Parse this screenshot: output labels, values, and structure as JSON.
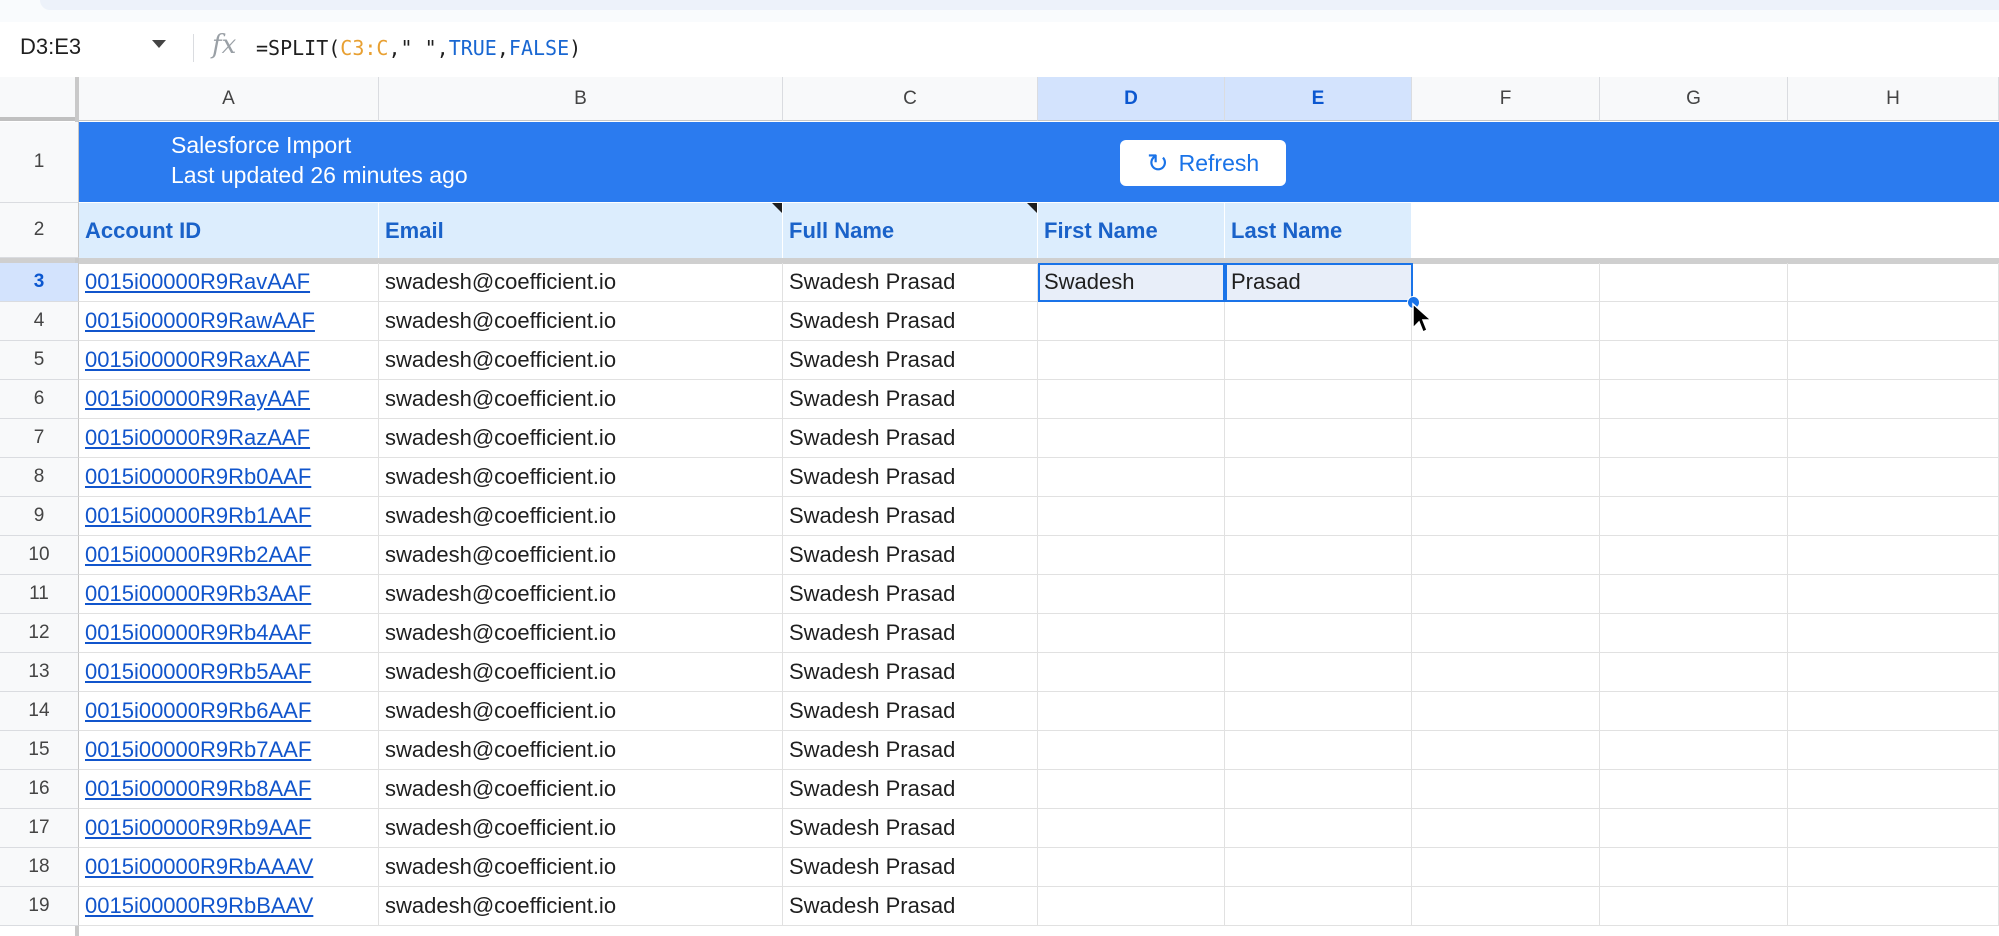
{
  "formula_bar": {
    "name_box": "D3:E3",
    "fx_label": "fx",
    "formula_parts": {
      "func": "=SPLIT(",
      "ref": "C3:C",
      "delim": ",\" \",",
      "arg1": "TRUE",
      "comma": ",",
      "arg2": "FALSE",
      "close": ")"
    }
  },
  "columns": [
    "A",
    "B",
    "C",
    "D",
    "E",
    "F",
    "G",
    "H"
  ],
  "selected_columns": [
    "D",
    "E"
  ],
  "row_numbers": [
    "1",
    "2",
    "3",
    "4",
    "5",
    "6",
    "7",
    "8",
    "9",
    "10",
    "11",
    "12",
    "13",
    "14",
    "15",
    "16",
    "17",
    "18",
    "19"
  ],
  "selected_row": "3",
  "banner": {
    "title": "Salesforce Import",
    "subtitle": "Last updated 26 minutes ago",
    "refresh_label": "Refresh",
    "background": "#2b7bef"
  },
  "headers": [
    "Account ID",
    "Email",
    "Full Name",
    "First Name",
    "Last Name"
  ],
  "rows": [
    {
      "id": "0015i00000R9RavAAF",
      "email": "swadesh@coefficient.io",
      "full": "Swadesh Prasad",
      "first": "Swadesh",
      "last": "Prasad"
    },
    {
      "id": "0015i00000R9RawAAF",
      "email": "swadesh@coefficient.io",
      "full": "Swadesh Prasad",
      "first": "",
      "last": ""
    },
    {
      "id": "0015i00000R9RaxAAF",
      "email": "swadesh@coefficient.io",
      "full": "Swadesh Prasad",
      "first": "",
      "last": ""
    },
    {
      "id": "0015i00000R9RayAAF",
      "email": "swadesh@coefficient.io",
      "full": "Swadesh Prasad",
      "first": "",
      "last": ""
    },
    {
      "id": "0015i00000R9RazAAF",
      "email": "swadesh@coefficient.io",
      "full": "Swadesh Prasad",
      "first": "",
      "last": ""
    },
    {
      "id": "0015i00000R9Rb0AAF",
      "email": "swadesh@coefficient.io",
      "full": "Swadesh Prasad",
      "first": "",
      "last": ""
    },
    {
      "id": "0015i00000R9Rb1AAF",
      "email": "swadesh@coefficient.io",
      "full": "Swadesh Prasad",
      "first": "",
      "last": ""
    },
    {
      "id": "0015i00000R9Rb2AAF",
      "email": "swadesh@coefficient.io",
      "full": "Swadesh Prasad",
      "first": "",
      "last": ""
    },
    {
      "id": "0015i00000R9Rb3AAF",
      "email": "swadesh@coefficient.io",
      "full": "Swadesh Prasad",
      "first": "",
      "last": ""
    },
    {
      "id": "0015i00000R9Rb4AAF",
      "email": "swadesh@coefficient.io",
      "full": "Swadesh Prasad",
      "first": "",
      "last": ""
    },
    {
      "id": "0015i00000R9Rb5AAF",
      "email": "swadesh@coefficient.io",
      "full": "Swadesh Prasad",
      "first": "",
      "last": ""
    },
    {
      "id": "0015i00000R9Rb6AAF",
      "email": "swadesh@coefficient.io",
      "full": "Swadesh Prasad",
      "first": "",
      "last": ""
    },
    {
      "id": "0015i00000R9Rb7AAF",
      "email": "swadesh@coefficient.io",
      "full": "Swadesh Prasad",
      "first": "",
      "last": ""
    },
    {
      "id": "0015i00000R9Rb8AAF",
      "email": "swadesh@coefficient.io",
      "full": "Swadesh Prasad",
      "first": "",
      "last": ""
    },
    {
      "id": "0015i00000R9Rb9AAF",
      "email": "swadesh@coefficient.io",
      "full": "Swadesh Prasad",
      "first": "",
      "last": ""
    },
    {
      "id": "0015i00000R9RbAAAV",
      "email": "swadesh@coefficient.io",
      "full": "Swadesh Prasad",
      "first": "",
      "last": ""
    },
    {
      "id": "0015i00000R9RbBAAV",
      "email": "swadesh@coefficient.io",
      "full": "Swadesh Prasad",
      "first": "",
      "last": ""
    }
  ],
  "icons": {
    "name_box_dropdown": "chevron-down-icon",
    "formula": "fx-icon",
    "refresh": "refresh-icon",
    "cursor": "mouse-pointer-icon"
  },
  "colors": {
    "accent": "#1a73e8",
    "link": "#1155cc",
    "header_fill": "#dcedfd",
    "header_text": "#1a62c9"
  }
}
